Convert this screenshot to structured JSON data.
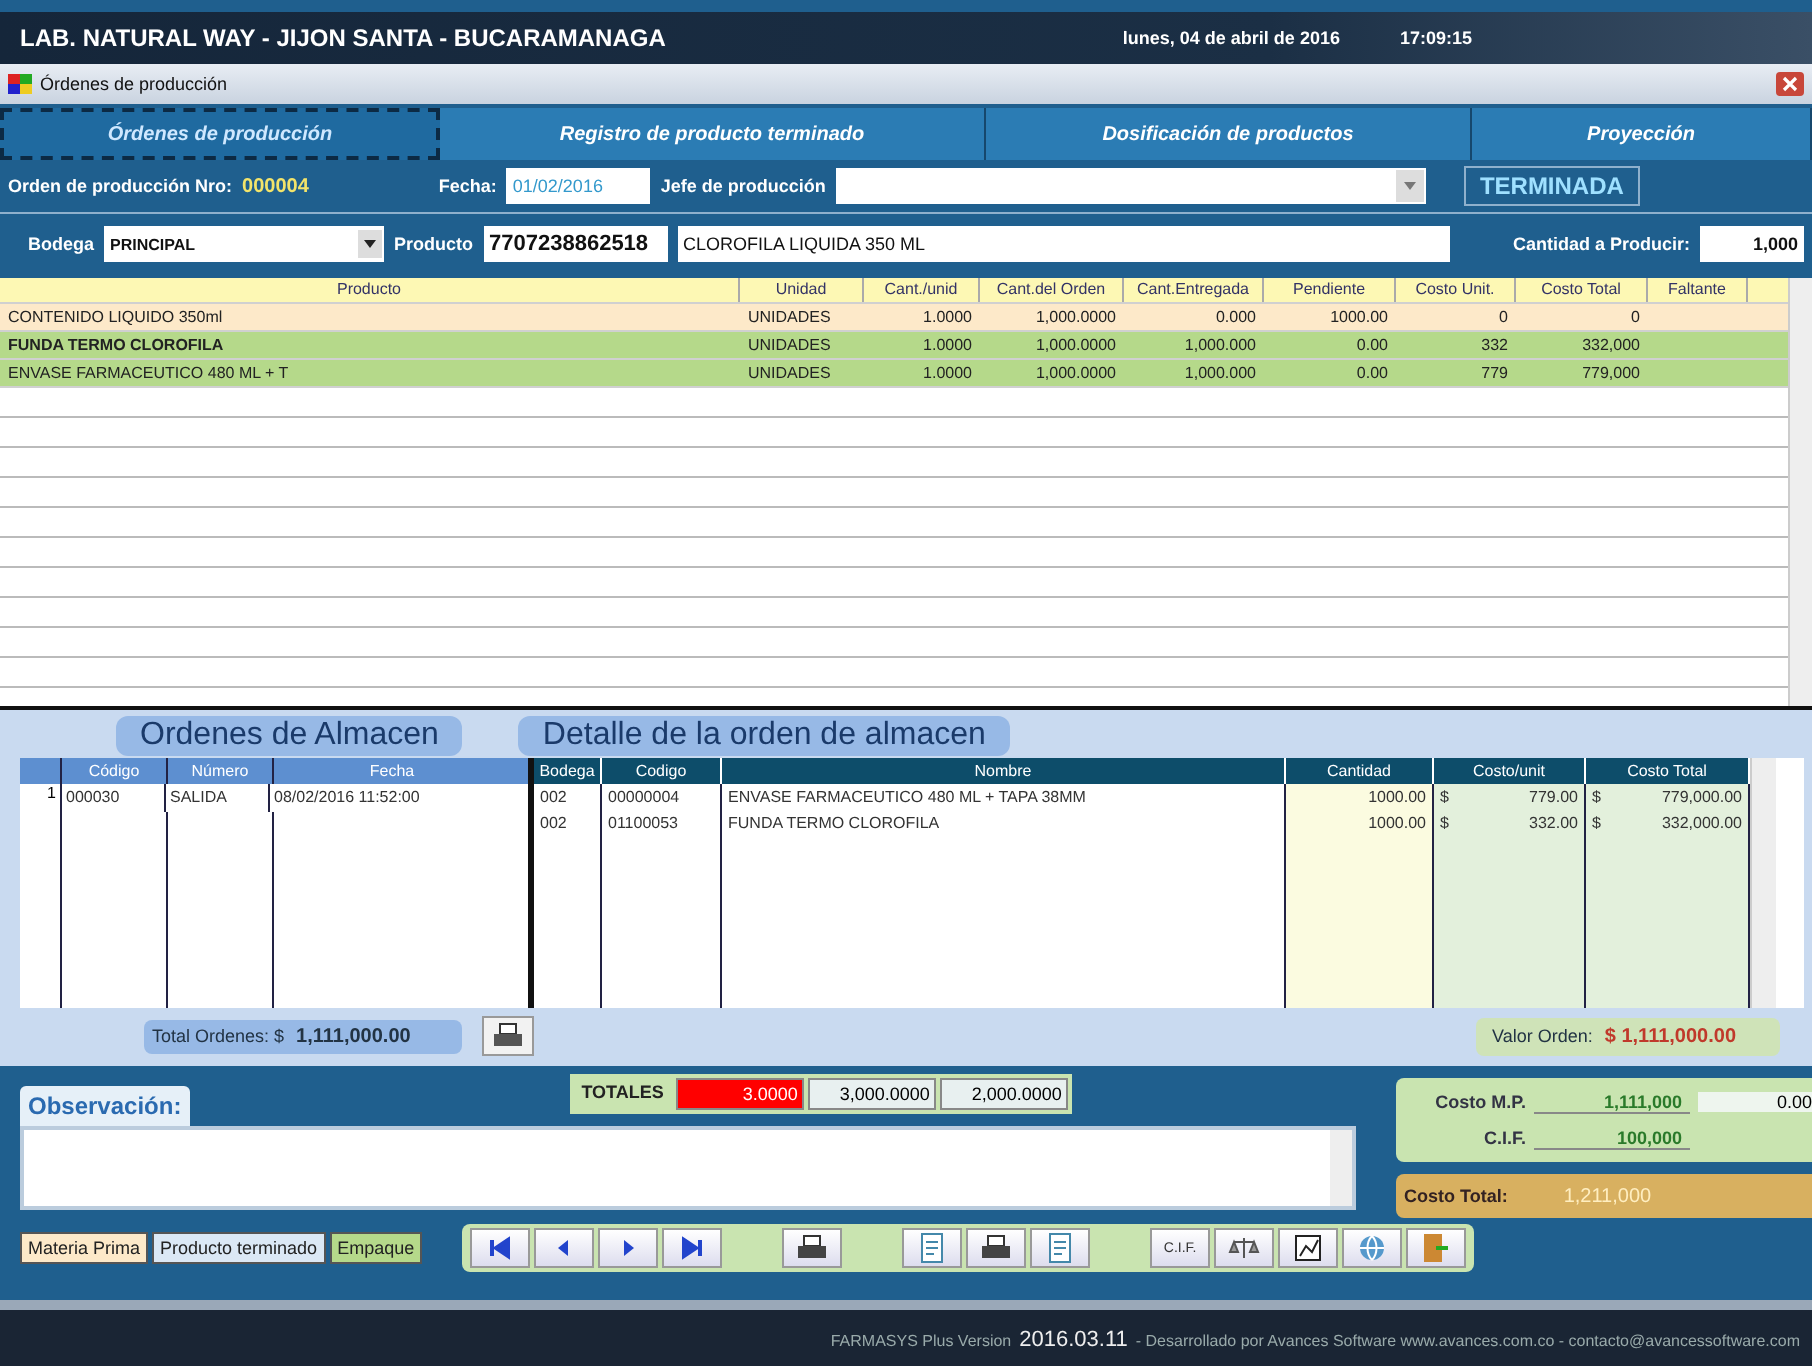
{
  "title_bar": {
    "company": "LAB. NATURAL WAY - JIJON SANTA - BUCARAMANAGA",
    "date": "lunes, 04 de abril de 2016",
    "time": "17:09:15"
  },
  "window": {
    "title": "Órdenes de producción"
  },
  "tabs": [
    {
      "label": "Órdenes de producción",
      "selected": true
    },
    {
      "label": "Registro de producto terminado",
      "selected": false
    },
    {
      "label": "Dosificación de productos",
      "selected": false
    },
    {
      "label": "Proyección",
      "selected": false
    }
  ],
  "order": {
    "number_label": "Orden de producción Nro:",
    "number": "000004",
    "date_label": "Fecha:",
    "date": "01/02/2016",
    "chief_label": "Jefe de producción",
    "status": "TERMINADA"
  },
  "product_row": {
    "warehouse_label": "Bodega",
    "warehouse": "PRINCIPAL",
    "product_label": "Producto",
    "product_code": "7707238862518",
    "product_name": "CLOROFILA LIQUIDA 350 ML",
    "qty_label": "Cantidad a Producir:",
    "qty": "1,000"
  },
  "materials": {
    "columns": [
      "Producto",
      "Unidad",
      "Cant./unid",
      "Cant.del Orden",
      "Cant.Entregada",
      "Pendiente",
      "Costo Unit.",
      "Costo Total",
      "Faltante"
    ],
    "rows": [
      {
        "color": "#fde9c9",
        "cells": [
          "CONTENIDO LIQUIDO 350ml",
          "UNIDADES",
          "1.0000",
          "1,000.0000",
          "0.000",
          "1000.00",
          "0",
          "0",
          ""
        ]
      },
      {
        "color": "#b5d98a",
        "cells": [
          "FUNDA TERMO CLOROFILA",
          "UNIDADES",
          "1.0000",
          "1,000.0000",
          "1,000.000",
          "0.00",
          "332",
          "332,000",
          ""
        ]
      },
      {
        "color": "#b5d98a",
        "cells": [
          "ENVASE FARMACEUTICO 480 ML + T",
          "UNIDADES",
          "1.0000",
          "1,000.0000",
          "1,000.000",
          "0.00",
          "779",
          "779,000",
          ""
        ]
      }
    ]
  },
  "warehouse_orders": {
    "title": "Ordenes de Almacen",
    "columns": [
      "Código",
      "Número",
      "Fecha"
    ],
    "rows": [
      {
        "index": "1",
        "cells": [
          "000030",
          "SALIDA",
          "08/02/2016 11:52:00"
        ]
      }
    ],
    "total_label": "Total Ordenes: $",
    "total": "1,111,000.00"
  },
  "order_detail": {
    "title": "Detalle de la orden de almacen",
    "columns": [
      "Bodega",
      "Codigo",
      "Nombre",
      "Cantidad",
      "Costo/unit",
      "Costo Total"
    ],
    "rows": [
      {
        "cells": [
          "002",
          "00000004",
          "ENVASE FARMACEUTICO 480 ML + TAPA 38MM",
          "1000.00",
          "$",
          "779.00",
          "$",
          "779,000.00"
        ]
      },
      {
        "cells": [
          "002",
          "01100053",
          "FUNDA TERMO CLOROFILA",
          "1000.00",
          "$",
          "332.00",
          "$",
          "332,000.00"
        ]
      }
    ],
    "value_label": "Valor Orden:",
    "value": "$ 1,111,000.00"
  },
  "observation": {
    "label": "Observación:"
  },
  "totals": {
    "label": "TOTALES",
    "values": [
      "3.0000",
      "3,000.0000",
      "2,000.0000"
    ]
  },
  "costs": {
    "mp_label": "Costo M.P.",
    "mp": "1,111,000",
    "mp_extra": "0.00",
    "cif_label": "C.I.F.",
    "cif": "100,000",
    "total_label": "Costo Total:",
    "total": "1,211,000"
  },
  "legend": [
    {
      "label": "Materia Prima",
      "color": "#fde9c9"
    },
    {
      "label": "Producto terminado",
      "color": "#dbe8f5"
    },
    {
      "label": "Empaque",
      "color": "#b5d98a"
    }
  ],
  "toolbar": [
    {
      "kind": "first"
    },
    {
      "kind": "prev"
    },
    {
      "kind": "next"
    },
    {
      "kind": "last"
    },
    {
      "kind": "gap"
    },
    {
      "kind": "printer"
    },
    {
      "kind": "gap"
    },
    {
      "kind": "doc"
    },
    {
      "kind": "printer"
    },
    {
      "kind": "doc"
    },
    {
      "kind": "gap"
    },
    {
      "kind": "text",
      "label": "C.I.F."
    },
    {
      "kind": "scale"
    },
    {
      "kind": "chart"
    },
    {
      "kind": "globe"
    },
    {
      "kind": "exit"
    }
  ],
  "footer": {
    "text": "FARMASYS Plus Version",
    "version": "2016.03.11",
    "credits": "- Desarrollado por Avances Software www.avances.com.co - contacto@avancessoftware.com"
  }
}
